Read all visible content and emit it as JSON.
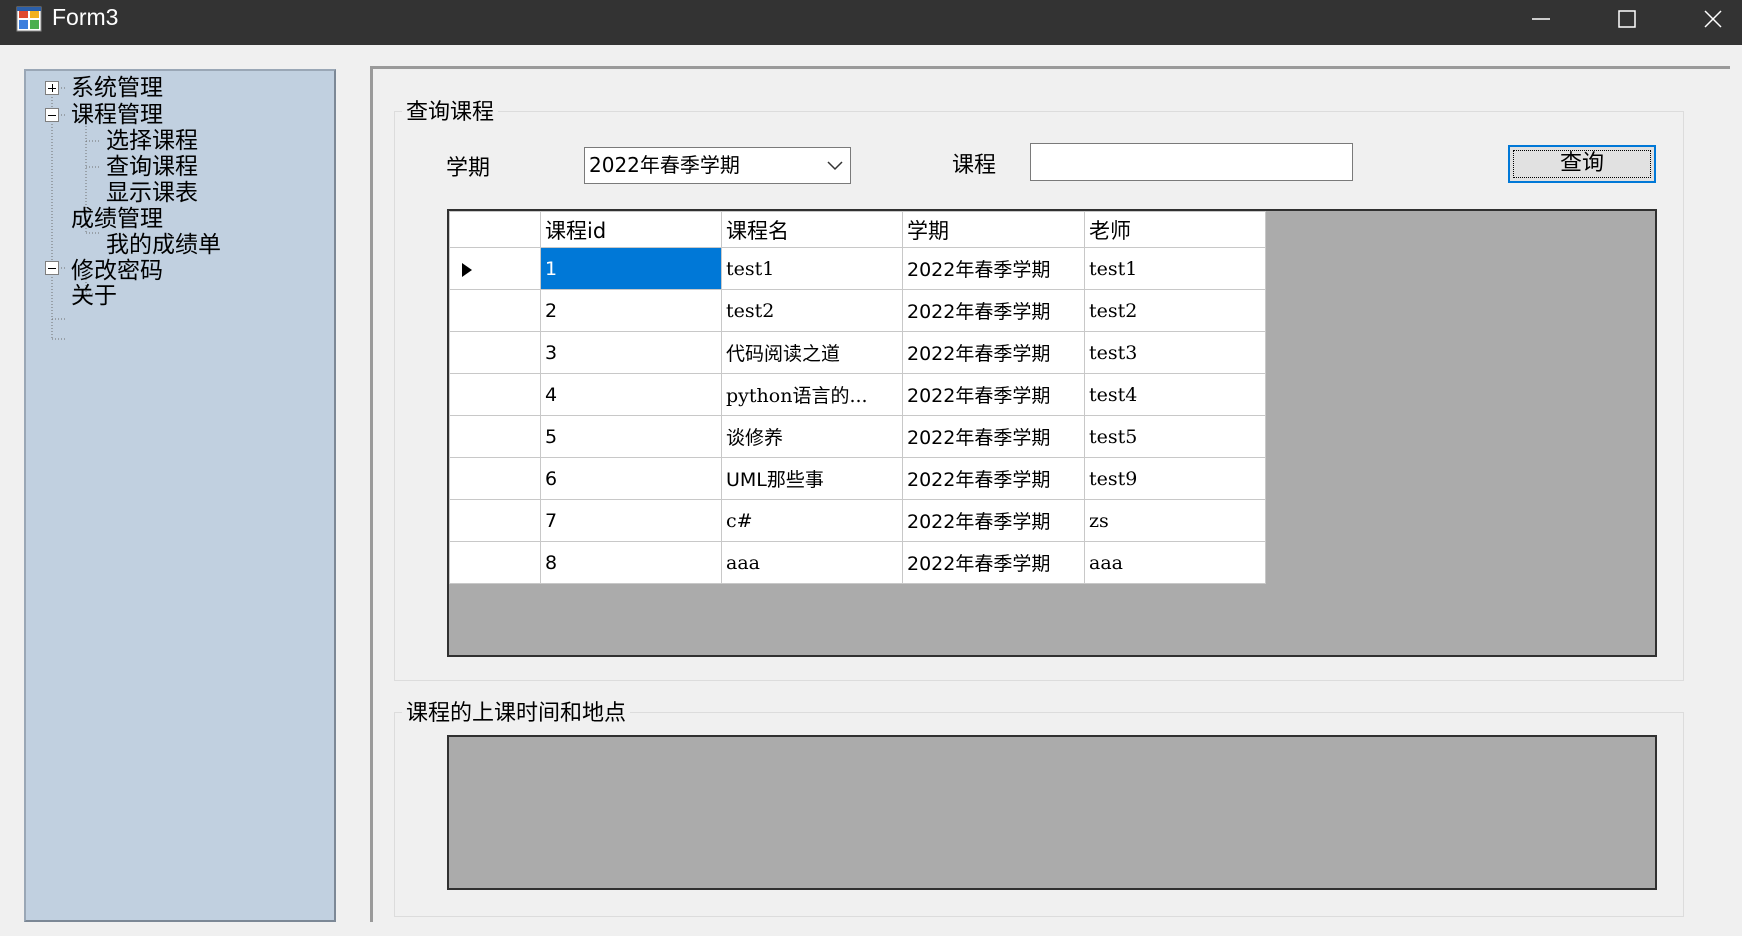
{
  "window": {
    "title": "Form3"
  },
  "tree": {
    "nodes": [
      {
        "label": "系统管理",
        "expander": "plus"
      },
      {
        "label": "课程管理",
        "expander": "minus"
      },
      {
        "label": "选择课程"
      },
      {
        "label": "查询课程"
      },
      {
        "label": "显示课表"
      },
      {
        "label": "成绩管理",
        "expander": "minus"
      },
      {
        "label": "我的成绩单"
      },
      {
        "label": "修改密码"
      },
      {
        "label": "关于"
      }
    ]
  },
  "query_group": {
    "title": "查询课程",
    "term_label": "学期",
    "term_value": "2022年春季学期",
    "course_label": "课程",
    "course_value": "",
    "query_button": "查询"
  },
  "grid": {
    "columns": [
      "课程id",
      "课程名",
      "学期",
      "老师"
    ],
    "rows": [
      [
        "1",
        "test1",
        "2022年春季学期",
        "test1"
      ],
      [
        "2",
        "test2",
        "2022年春季学期",
        "test2"
      ],
      [
        "3",
        "代码阅读之道",
        "2022年春季学期",
        "test3"
      ],
      [
        "4",
        "python语言的...",
        "2022年春季学期",
        "test4"
      ],
      [
        "5",
        "谈修养",
        "2022年春季学期",
        "test5"
      ],
      [
        "6",
        "UML那些事",
        "2022年春季学期",
        "test9"
      ],
      [
        "7",
        "c#",
        "2022年春季学期",
        "zs"
      ],
      [
        "8",
        "aaa",
        "2022年春季学期",
        "aaa"
      ]
    ]
  },
  "schedule_group": {
    "title": "课程的上课时间和地点"
  },
  "colors": {
    "titlebar": "#333333",
    "tree_bg": "#c1d0e0",
    "selection": "#0078d7",
    "grid_bg": "#ababab"
  }
}
